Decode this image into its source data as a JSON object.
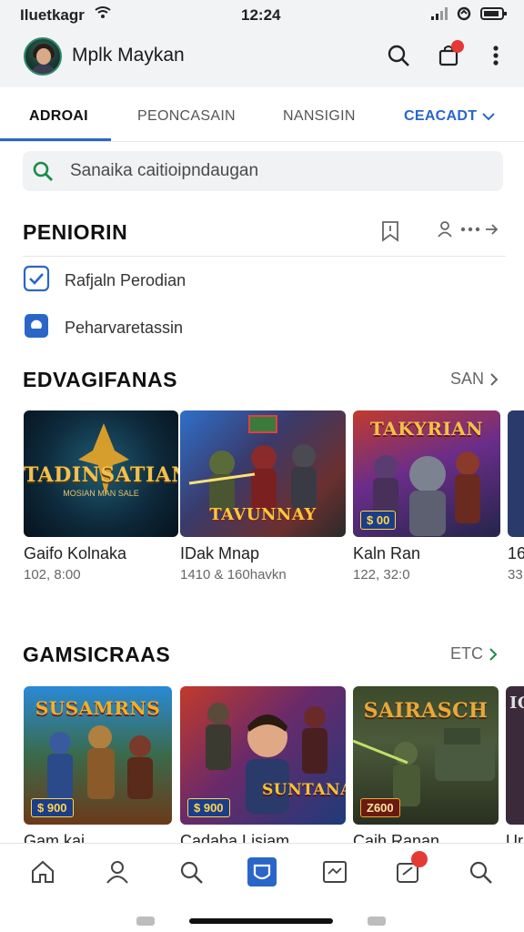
{
  "status_bar": {
    "carrier": "Iluetkagr",
    "time": "12:24"
  },
  "header": {
    "user_name": "Mplk Maykan",
    "notification_badge": ""
  },
  "tabs": [
    {
      "label": "ADROAI",
      "active": true
    },
    {
      "label": "PEONCASAIN",
      "active": false
    },
    {
      "label": "NANSIGIN",
      "active": false
    },
    {
      "label": "CEACADT",
      "active": false
    }
  ],
  "search": {
    "placeholder": "Sanaika caitioipndaugan"
  },
  "section1": {
    "title": "PENIORIN",
    "items": [
      {
        "label": "Rafjaln Perodian",
        "icon": "checkbox-checked-icon"
      },
      {
        "label": "Peharvaretassin",
        "icon": "toggle-icon"
      }
    ]
  },
  "section2": {
    "title": "EDVAGIFANAS",
    "see_all": "SAN",
    "cards": [
      {
        "name": "Gaifo Kolnaka",
        "meta": "102, 8:00",
        "thumb_title": "TADINSATIAN",
        "thumb_subtitle": "MOSIAN MAN SALE"
      },
      {
        "name": "IDak Mnap",
        "meta": "1410 & 160havkn",
        "thumb_title": "TAVUNNAY",
        "thumb_subtitle": ""
      },
      {
        "name": "Kaln Ran",
        "meta": "122, 32:0",
        "thumb_title": "TAKYRIAN",
        "thumb_subtitle": "",
        "price": "$ 00"
      },
      {
        "name": "16",
        "meta": "33"
      }
    ]
  },
  "section3": {
    "title": "GAMSICRAAS",
    "see_all": "ETC",
    "cards": [
      {
        "name": "Gam kai",
        "thumb_title": "SUSAMRNS",
        "price": "$ 900"
      },
      {
        "name": "Cadaba Lisiam",
        "thumb_title": "SUNTANAN",
        "price": "$ 900"
      },
      {
        "name": "Caih Ranan",
        "thumb_title": "SAIRASCH",
        "price": "Z600"
      },
      {
        "name": "Ur",
        "thumb_title": "IG"
      }
    ]
  },
  "bottom_nav": {
    "items": [
      "home-icon",
      "profile-icon",
      "search-icon",
      "store-icon",
      "activity-icon",
      "notifications-icon",
      "search-icon"
    ],
    "active_index": 3,
    "badge": ""
  },
  "colors": {
    "accent": "#2a66c8",
    "badge": "#e53935",
    "search_bg": "#f0f2f4"
  }
}
